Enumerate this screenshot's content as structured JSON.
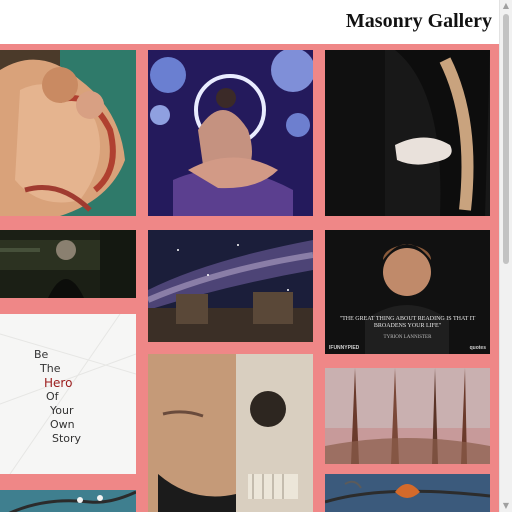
{
  "page": {
    "title": "Masonry Gallery"
  },
  "colors": {
    "background": "#ef8787",
    "header_bg": "#ffffff"
  },
  "tiles": [
    {
      "name": "embracing-couple-painting-image"
    },
    {
      "name": "cosmic-lovers-art-image"
    },
    {
      "name": "dark-embrace-photo-image"
    },
    {
      "name": "dark-film-still-image"
    },
    {
      "name": "milky-way-night-sky-image"
    },
    {
      "name": "quote-portrait-image",
      "quote": "\"THE GREAT THING ABOUT READING IS THAT IT BROADENS YOUR LIFE\"",
      "attribution": "TYRION LANNISTER",
      "brand_left": "IFUNNYPIED",
      "brand_right": "quotes"
    },
    {
      "name": "be-the-hero-text-image",
      "lines": [
        "Be",
        "The",
        "Hero",
        "Of",
        "Your",
        "Own",
        "Story"
      ]
    },
    {
      "name": "half-face-skull-image"
    },
    {
      "name": "misty-forest-image"
    },
    {
      "name": "tree-branch-image"
    },
    {
      "name": "autumn-leaf-image"
    }
  ]
}
